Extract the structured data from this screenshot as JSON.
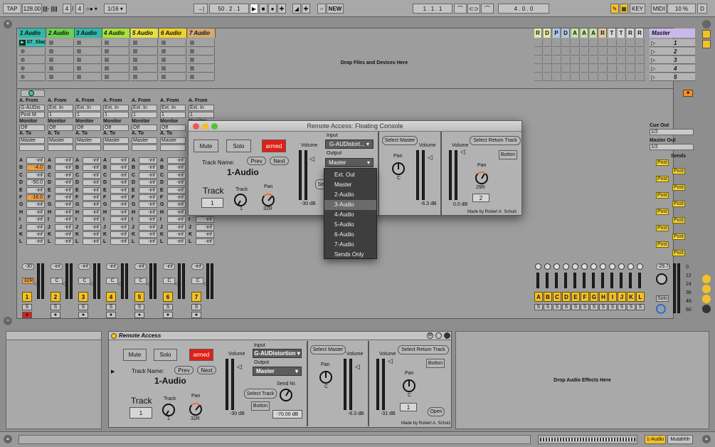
{
  "transport": {
    "tap": "TAP",
    "tempo": "128.00",
    "sig_num": "4",
    "sig_den": "4",
    "quant": "1/16",
    "position": "50 .  2 .  1",
    "new": "NEW",
    "loop_start": "1 .  1 .  1",
    "loop_len": "4 .  0 .  0",
    "key": "KEY",
    "midi": "MIDI",
    "cpu": "10 %",
    "d": "D"
  },
  "tracks": [
    {
      "name": "1 Audio",
      "color": "#2fb8a8"
    },
    {
      "name": "2 Audio",
      "color": "#6fcf4f"
    },
    {
      "name": "3 Audio",
      "color": "#2fb8a8"
    },
    {
      "name": "4 Audio",
      "color": "#a8e040"
    },
    {
      "name": "5 Audio",
      "color": "#e8e040"
    },
    {
      "name": "6 Audio",
      "color": "#f0d030"
    },
    {
      "name": "7 Audio",
      "color": "#d4aa70"
    }
  ],
  "clip": "07_Slac",
  "drop_files": "Drop Files and Devices Here",
  "returns": [
    "R",
    "D",
    "P",
    "D",
    "A",
    "A",
    "A",
    "R",
    "T",
    "T",
    "R",
    "R"
  ],
  "master": {
    "name": "Master",
    "scenes": [
      "1",
      "2",
      "3",
      "4",
      "5"
    ],
    "volume": "-29.74",
    "cue_out": "Cue Out",
    "cue_val": "1/2",
    "master_out": "Master Out",
    "master_val": "1/2",
    "sends": "Sends",
    "solo": "Solo",
    "scale": [
      "0",
      "12",
      "24",
      "36",
      "48",
      "60"
    ]
  },
  "io": {
    "a_from": "A. From",
    "monitor": "Monitor",
    "a_to": "A. To",
    "from_vals": [
      "G-AUDis",
      "Ext. In",
      "Ext. In",
      "Ext. In",
      "Ext. In",
      "Ext. In",
      "Ext. In"
    ],
    "sub_vals": [
      "Post M",
      "1",
      "1",
      "1",
      "1",
      "1",
      "1"
    ],
    "mon_val": "Off",
    "to_val": "Master"
  },
  "sends": {
    "letters": [
      "A",
      "B",
      "C",
      "D",
      "E",
      "F",
      "G",
      "H",
      "I",
      "J",
      "K",
      "L"
    ],
    "t1": [
      "-inf",
      "-4.0",
      "-inf",
      "-50.0",
      "-inf",
      "-16.0",
      "-inf",
      "-inf",
      "-inf",
      "-inf",
      "-inf",
      "-inf"
    ],
    "inf": "-inf"
  },
  "channels": {
    "vol": [
      "-30",
      "-inf",
      "-inf",
      "-inf",
      "-inf",
      "-inf",
      "-inf"
    ],
    "pan": "32R",
    "pan_c": "C",
    "nums": [
      "1",
      "2",
      "3",
      "4",
      "5",
      "6",
      "7"
    ],
    "s": "S"
  },
  "return_letters": [
    "A",
    "B",
    "C",
    "D",
    "E",
    "F",
    "G",
    "H",
    "I",
    "J",
    "K",
    "L"
  ],
  "console": {
    "title": "Remote Access: Floating Console",
    "mute": "Mute",
    "solo": "Solo",
    "armed": "armed",
    "track_name_label": "Track Name:",
    "prev": "Prev",
    "next": "Next",
    "track_name": "1-Audio",
    "track_label": "Track",
    "track_num": "1",
    "track_small": "Track",
    "track_val": "1",
    "pan": "Pan",
    "pan_val": "32R",
    "volume": "Volume",
    "vol_db": "-30 dB",
    "input": "Input",
    "input_val": "G-AUDistort...",
    "output": "Output",
    "output_val": "Master",
    "sel": "Se",
    "select_master": "Select Master",
    "pan2": "Pan",
    "pan2_val": "C",
    "volume2": "Volume",
    "vol2_db": "-6.3 dB",
    "select_return": "Select Return Track",
    "volume3": "Volume",
    "button": "Button",
    "pan3": "Pan",
    "pan3_val": "29R",
    "ret_num": "2",
    "vol3_db": "0.0 dB",
    "made_by": "Made by Robert A. Schulz"
  },
  "dropdown": {
    "items": [
      "Ext. Out",
      "Master",
      "2-Audio",
      "3-Audio",
      "4-Audio",
      "5-Audio",
      "6-Audio",
      "7-Audio",
      "Sends Only"
    ],
    "highlight": "3-Audio"
  },
  "remote": {
    "title": "Remote Access",
    "mute": "Mute",
    "solo": "Solo",
    "armed": "armed",
    "track_name_label": "Track Name:",
    "prev": "Prev",
    "next": "Next",
    "track_name": "1-Audio",
    "track_label": "Track",
    "track_num": "1",
    "track_small": "Track",
    "track_val": "1",
    "pan": "Pan",
    "pan_val": "32R",
    "volume": "Volume",
    "vol_db": "-30 dB",
    "input": "Input",
    "input_val": "G-AUDistortion",
    "output": "Output",
    "output_val": "Master",
    "select_track": "Select Track",
    "send_nr": "Send Nr.",
    "send_button": "Button",
    "send_val": "-70.00 dB",
    "select_master": "Select Master",
    "volume2": "Volume",
    "pan2": "Pan",
    "pan2_val": "C",
    "vol2_db": "-6.3 dB",
    "select_return": "Select Return Track",
    "volume3": "Volume",
    "button": "Button",
    "pan3": "Pan",
    "pan3_val": "C",
    "ret_num": "1",
    "vol3_db": "-31 dB",
    "open": "Open",
    "made_by": "Made by Robert A. Schulz"
  },
  "drop_effects": "Drop Audio Effects Here",
  "status": {
    "track": "1-Audio",
    "device": "Mutahhh"
  }
}
